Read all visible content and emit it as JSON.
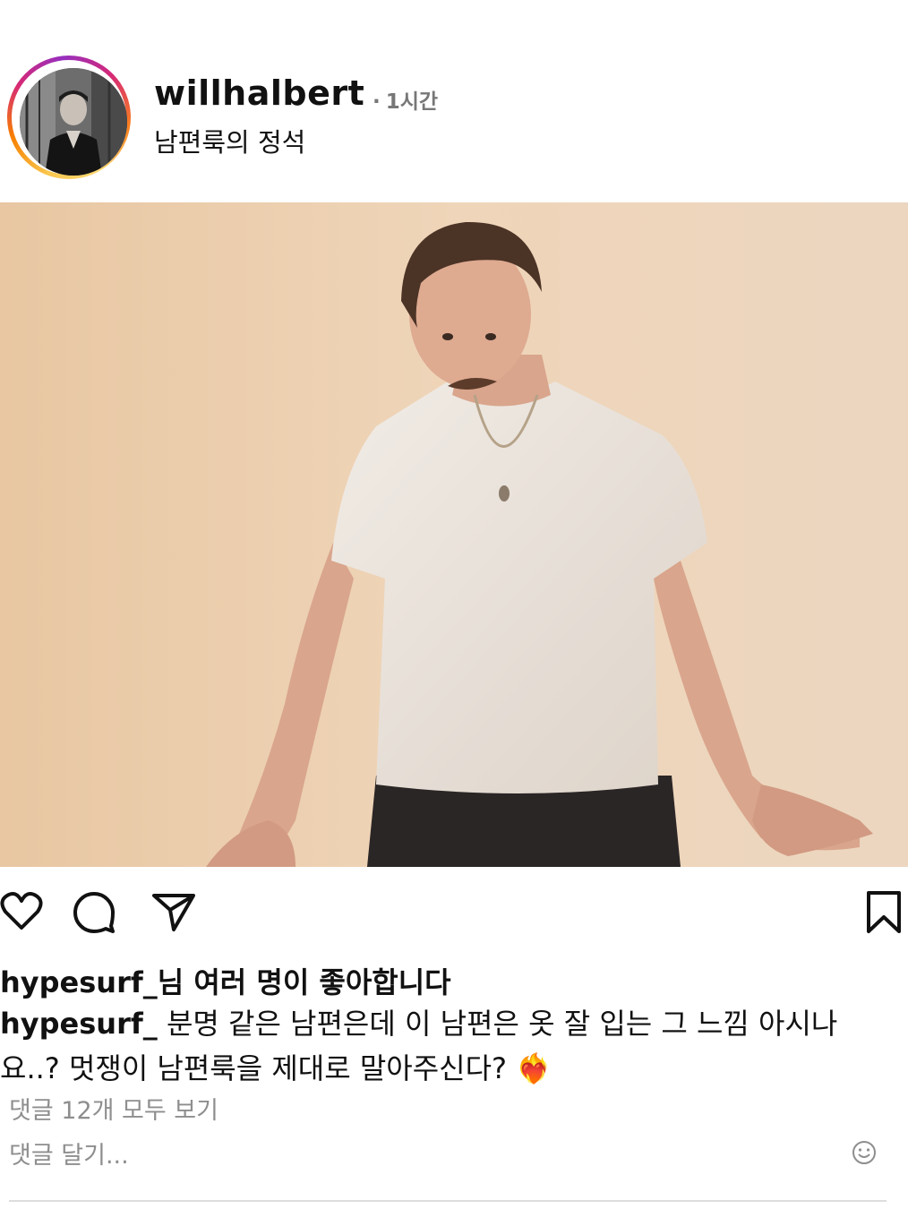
{
  "post": {
    "username": "willhalbert",
    "time_dot": "·",
    "time": "1시간",
    "subtitle": "남편룩의 정석"
  },
  "actions": {
    "like_icon": "heart-icon",
    "comment_icon": "comment-icon",
    "share_icon": "send-icon",
    "save_icon": "bookmark-icon"
  },
  "likes": {
    "user": "hypesurf_",
    "text": "님 여러 명이 좋아합니다"
  },
  "caption": {
    "user": "hypesurf_",
    "text": " 분명 같은 남편은데 이 남편은 옷 잘 입는 그 느낌 아시나요..? 멋쟁이 남편룩을 제대로 말아주신다? ",
    "emoji": "❤️‍🔥"
  },
  "comments": {
    "view_all": "댓글 12개 모두 보기",
    "add_placeholder": "댓글 달기..."
  },
  "colors": {
    "ring_gradient": [
      "#feda75",
      "#fa7e1e",
      "#d62976",
      "#962fbf"
    ],
    "muted_text": "#8e8e8e"
  }
}
